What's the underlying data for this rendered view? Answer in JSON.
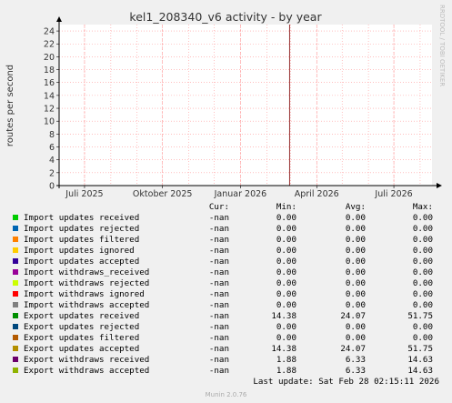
{
  "chart_data": {
    "type": "line",
    "title": "kel1_208340_v6 activity - by year",
    "ylabel": "routes per second",
    "watermark": "RRDTOOL / TOBI OETIKER",
    "ylim": [
      0,
      25
    ],
    "yticks": [
      0,
      2,
      4,
      6,
      8,
      10,
      12,
      14,
      16,
      18,
      20,
      22,
      24
    ],
    "xticks": [
      {
        "label": "Juli 2025",
        "date": "2025-07-01"
      },
      {
        "label": "Oktober 2025",
        "date": "2025-10-01"
      },
      {
        "label": "Januar 2026",
        "date": "2026-01-01"
      },
      {
        "label": "April 2026",
        "date": "2026-04-01"
      },
      {
        "label": "Juli 2026",
        "date": "2026-07-01"
      }
    ],
    "xlim": [
      "2025-06-01",
      "2026-08-15"
    ],
    "grid": true,
    "marker_date": "2026-02-28",
    "series": []
  },
  "colors": {
    "background": "#f0f0f0",
    "plot_bg": "#ffffff",
    "grid": "#ff9999",
    "axis": "#000000",
    "marker": "#993333",
    "text": "#333333"
  },
  "legend": {
    "headers": {
      "cur": "Cur:",
      "min": "Min:",
      "avg": "Avg:",
      "max": "Max:"
    },
    "rows": [
      {
        "label": "Import updates received",
        "color": "#00cc00",
        "cur": "-nan",
        "min": "0.00",
        "avg": "0.00",
        "max": "0.00"
      },
      {
        "label": "Import updates rejected",
        "color": "#0066b3",
        "cur": "-nan",
        "min": "0.00",
        "avg": "0.00",
        "max": "0.00"
      },
      {
        "label": "Import updates filtered",
        "color": "#ff8000",
        "cur": "-nan",
        "min": "0.00",
        "avg": "0.00",
        "max": "0.00"
      },
      {
        "label": "Import updates ignored",
        "color": "#ffcc00",
        "cur": "-nan",
        "min": "0.00",
        "avg": "0.00",
        "max": "0.00"
      },
      {
        "label": "Import updates accepted",
        "color": "#330099",
        "cur": "-nan",
        "min": "0.00",
        "avg": "0.00",
        "max": "0.00"
      },
      {
        "label": "Import withdraws_received",
        "color": "#990099",
        "cur": "-nan",
        "min": "0.00",
        "avg": "0.00",
        "max": "0.00"
      },
      {
        "label": "Import withdraws rejected",
        "color": "#ccff00",
        "cur": "-nan",
        "min": "0.00",
        "avg": "0.00",
        "max": "0.00"
      },
      {
        "label": "Import withdraws ignored",
        "color": "#ff0000",
        "cur": "-nan",
        "min": "0.00",
        "avg": "0.00",
        "max": "0.00"
      },
      {
        "label": "Import withdraws accepted",
        "color": "#808080",
        "cur": "-nan",
        "min": "0.00",
        "avg": "0.00",
        "max": "0.00"
      },
      {
        "label": "Export updates received",
        "color": "#008f00",
        "cur": "-nan",
        "min": "14.38",
        "avg": "24.07",
        "max": "51.75"
      },
      {
        "label": "Export updates rejected",
        "color": "#00487d",
        "cur": "-nan",
        "min": "0.00",
        "avg": "0.00",
        "max": "0.00"
      },
      {
        "label": "Export updates filtered",
        "color": "#b35a00",
        "cur": "-nan",
        "min": "0.00",
        "avg": "0.00",
        "max": "0.00"
      },
      {
        "label": "Export updates accepted",
        "color": "#b38f00",
        "cur": "-nan",
        "min": "14.38",
        "avg": "24.07",
        "max": "51.75"
      },
      {
        "label": "Export withdraws received",
        "color": "#6b006b",
        "cur": "-nan",
        "min": "1.88",
        "avg": "6.33",
        "max": "14.63"
      },
      {
        "label": "Export withdraws accepted",
        "color": "#8fb300",
        "cur": "-nan",
        "min": "1.88",
        "avg": "6.33",
        "max": "14.63"
      }
    ]
  },
  "footer": {
    "last_update": "Last update: Sat Feb 28 02:15:11 2026",
    "munin": "Munin 2.0.76"
  }
}
